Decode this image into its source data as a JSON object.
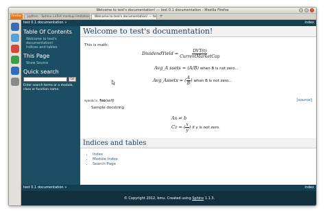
{
  "window": {
    "title": "Welcome to test's documentation! — test 0.1 documentation - Mozilla Firefox"
  },
  "tabs": {
    "menu_label": "Firefox",
    "items": [
      {
        "label": "python - Sphinx LaTeX markup limitations..."
      },
      {
        "label": "Welcome to test's documentation! — test..."
      }
    ],
    "new_tab": "+"
  },
  "relbar": {
    "left": "test 0.1 documentation »",
    "right": "index"
  },
  "sidebar": {
    "toc_heading": "Table Of Contents",
    "toc_items": [
      "Welcome to test's",
      "documentation!",
      "Indices and tables"
    ],
    "this_page_heading": "This Page",
    "show_source": "Show Source",
    "quick_search_heading": "Quick search",
    "search_value": "",
    "go_label": "Go",
    "hint": "Enter search terms or a module, class or function name."
  },
  "content": {
    "title": "Welcome to test's documentation!",
    "intro": "This is math:",
    "eq1": {
      "lhs": "DividendYield =",
      "num": "DVT(t)",
      "den": "CurrentMarketCap"
    },
    "eq2": {
      "lhs": "Avg_A ssets =",
      "paren": "(A/B)",
      "tail": "when B is not zero..."
    },
    "eq3": {
      "lhs": "Avg_Assets =",
      "num": "A",
      "den": "B",
      "tail": "when B is not zero..."
    },
    "func": {
      "module": "mymodule.",
      "name": "foo",
      "args": "(self)",
      "source": "[source]"
    },
    "docstring": "Sample docstring",
    "eq4": {
      "line1": "Ax = b",
      "line2_lhs": "Cz =",
      "num": "x",
      "den": "y",
      "tail": "if y is not zero."
    },
    "section_title": "Indices and tables",
    "index_links": [
      "Index",
      "Module Index",
      "Search Page"
    ]
  },
  "footer": {
    "text": "© Copyright 2012, bmu. Created using",
    "sphinx": "Sphinx",
    "version": "1.1.3."
  },
  "colors": {
    "relbar": "#133f52",
    "sidebar": "#1c4e63",
    "sidebar_link": "#98dbcc",
    "footer": "#11303d",
    "heading": "#20435c"
  }
}
